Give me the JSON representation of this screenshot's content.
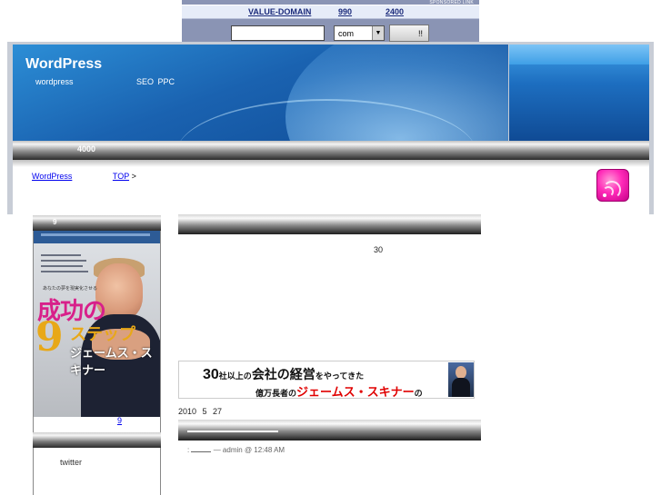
{
  "domain_ad": {
    "sponsor": "SPONSORED LINK",
    "brand": "VALUE-DOMAIN",
    "price_1": "990",
    "price_2": "2400",
    "search_placeholder": "",
    "tld": "com",
    "search_button": "!!"
  },
  "header": {
    "site_title": "WordPress",
    "tagline_1": "wordpress",
    "tagline_2": "SEO PPC"
  },
  "nav": {
    "text": "4000"
  },
  "breadcrumb": {
    "link_1": "WordPress",
    "link_2": "TOP",
    "separator": ">"
  },
  "sidebar": {
    "heading_1": "9",
    "book_link": "9",
    "heading_3": "twitter",
    "book_cover": {
      "title": "成功の",
      "numeral": "9",
      "title_end": "ステップ",
      "author": "ジェームス・スキナー",
      "subtitle": "あなたの夢を現実化させる"
    }
  },
  "main": {
    "count": "30",
    "banner": {
      "line1_num": "30",
      "line1_a": "社以上の",
      "line1_b": "会社の経営",
      "line1_c": "をやってきた",
      "line2_a": "億万長者の",
      "line2_name": "ジェームス・スキナー",
      "line2_b": "の"
    },
    "date": "2010 5 27",
    "meta_prefix": ":",
    "meta_author": "— admin @ 12:48 AM"
  }
}
